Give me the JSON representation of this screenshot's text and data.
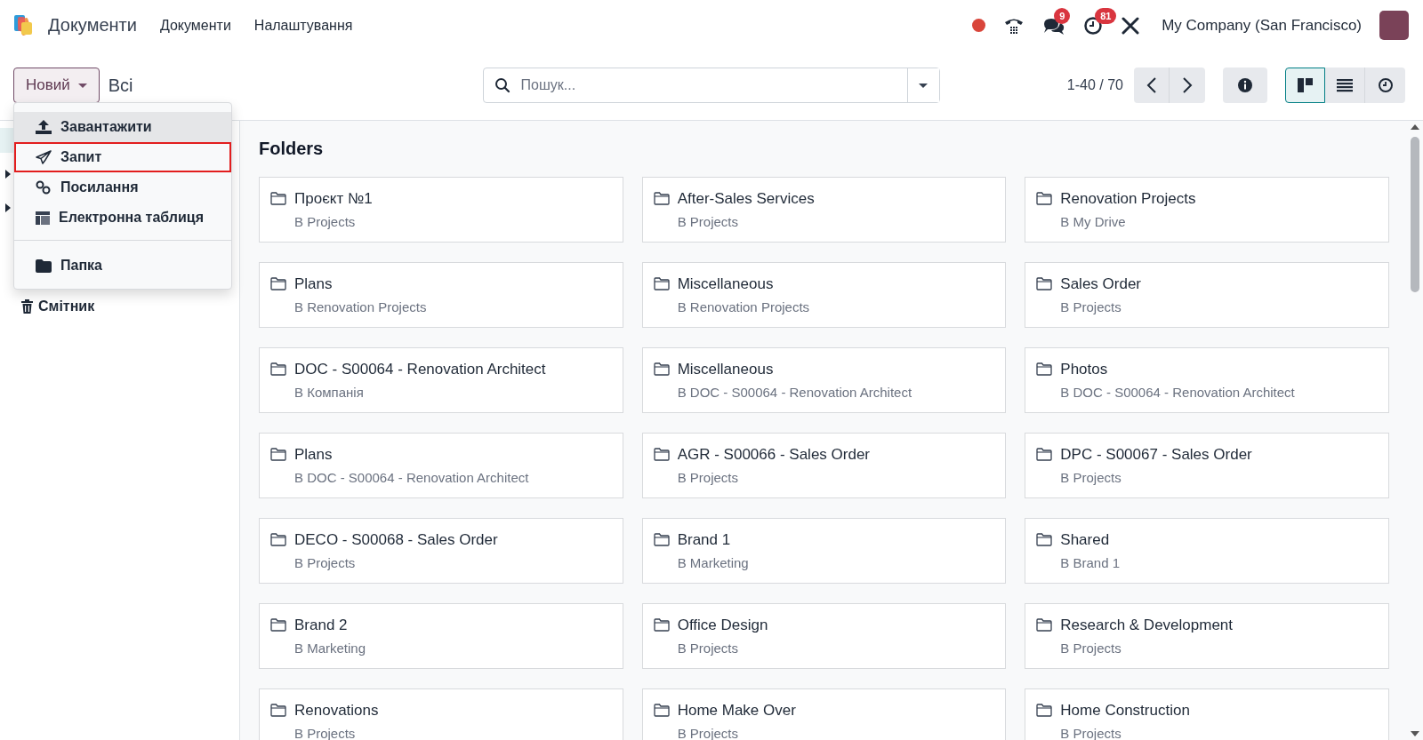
{
  "navbar": {
    "app_name": "Документи",
    "menu": [
      {
        "label": "Документи"
      },
      {
        "label": "Налаштування"
      }
    ],
    "chat_badge": "9",
    "activity_badge": "81",
    "company": "My Company (San Francisco)"
  },
  "control_panel": {
    "new_button": "Новий",
    "breadcrumb": "Всі",
    "search": {
      "placeholder": "Пошук..."
    },
    "pager": "1-40 / 70",
    "views": [
      {
        "selected": true
      },
      {
        "selected": false
      },
      {
        "selected": false
      }
    ]
  },
  "new_menu": {
    "groups": [
      [
        {
          "label": "Завантажити",
          "hovered": true,
          "highlighted": false
        },
        {
          "label": "Запит",
          "hovered": false,
          "highlighted": true
        },
        {
          "label": "Посилання",
          "hovered": false,
          "highlighted": false
        },
        {
          "label": "Електронна таблиця",
          "hovered": false,
          "highlighted": false
        }
      ],
      [
        {
          "label": "Папка",
          "hovered": false,
          "highlighted": false
        }
      ]
    ]
  },
  "sidebar": {
    "items": [
      {
        "label": "Смітник"
      }
    ]
  },
  "main": {
    "section_title": "Folders",
    "folders": [
      {
        "name": "Проєкт №1",
        "location": "В Projects"
      },
      {
        "name": "After-Sales Services",
        "location": "В Projects"
      },
      {
        "name": "Renovation Projects",
        "location": "В My Drive"
      },
      {
        "name": "Plans",
        "location": "В Renovation Projects"
      },
      {
        "name": "Miscellaneous",
        "location": "В Renovation Projects"
      },
      {
        "name": "Sales Order",
        "location": "В Projects"
      },
      {
        "name": "DOC - S00064 - Renovation Architect",
        "location": "В Компанія"
      },
      {
        "name": "Miscellaneous",
        "location": "В DOC - S00064 - Renovation Architect"
      },
      {
        "name": "Photos",
        "location": "В DOC - S00064 - Renovation Architect"
      },
      {
        "name": "Plans",
        "location": "В DOC - S00064 - Renovation Architect"
      },
      {
        "name": "AGR - S00066 - Sales Order",
        "location": "В Projects"
      },
      {
        "name": "DPC - S00067 - Sales Order",
        "location": "В Projects"
      },
      {
        "name": "DECO - S00068 - Sales Order",
        "location": "В Projects"
      },
      {
        "name": "Brand 1",
        "location": "В Marketing"
      },
      {
        "name": "Shared",
        "location": "В Brand 1"
      },
      {
        "name": "Brand 2",
        "location": "В Marketing"
      },
      {
        "name": "Office Design",
        "location": "В Projects"
      },
      {
        "name": "Research & Development",
        "location": "В Projects"
      },
      {
        "name": "Renovations",
        "location": "В Projects"
      },
      {
        "name": "Home Make Over",
        "location": "В Projects"
      },
      {
        "name": "Home Construction",
        "location": "В Projects"
      }
    ]
  }
}
